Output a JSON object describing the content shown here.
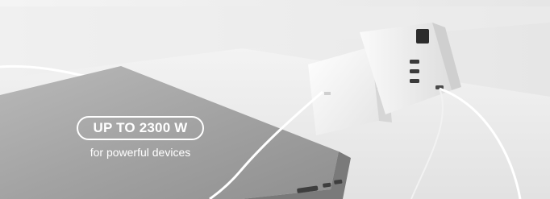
{
  "promo": {
    "headline": "UP TO 2300 W",
    "tagline": "for powerful devices"
  },
  "colors": {
    "background": "#ffffff",
    "wall": "#eeeeee",
    "desk": "#f4f4f4",
    "laptop": "#a9a9a9",
    "text": "#ffffff"
  },
  "scene_objects": [
    "laptop",
    "power-adapter",
    "travel-adapter",
    "charging-cable"
  ]
}
